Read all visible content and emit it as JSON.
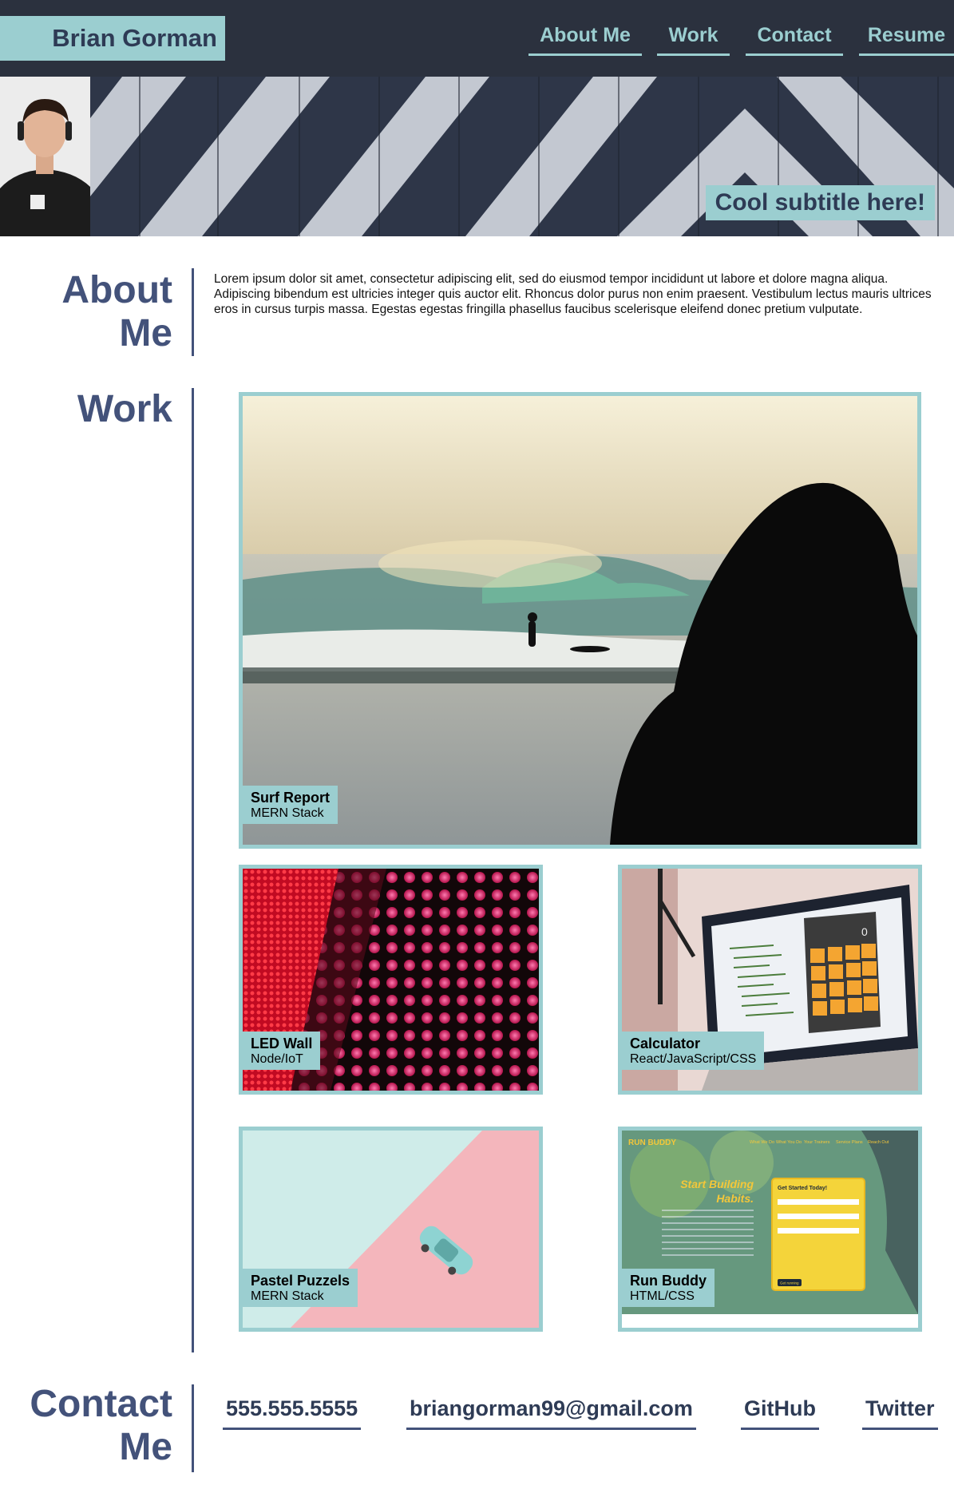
{
  "header": {
    "brand": "Brian Gorman",
    "nav": [
      {
        "label": "About Me"
      },
      {
        "label": "Work"
      },
      {
        "label": "Contact"
      },
      {
        "label": "Resume"
      }
    ]
  },
  "hero": {
    "subtitle": "Cool subtitle here!"
  },
  "about": {
    "title_line1": "About",
    "title_line2": "Me",
    "text": "Lorem ipsum dolor sit amet, consectetur adipiscing elit, sed do eiusmod tempor incididunt ut labore et dolore magna aliqua. Adipiscing bibendum est ultricies integer quis auctor elit. Rhoncus dolor purus non enim praesent. Vestibulum lectus mauris ultrices eros in cursus turpis massa. Egestas egestas fringilla phasellus faucibus scelerisque eleifend donec pretium vulputate."
  },
  "work": {
    "title": "Work",
    "projects": [
      {
        "title": "Surf Report",
        "stack": "MERN Stack"
      },
      {
        "title": "LED Wall",
        "stack": "Node/IoT"
      },
      {
        "title": "Calculator",
        "stack": "React/JavaScript/CSS"
      },
      {
        "title": "Pastel Puzzels",
        "stack": "MERN Stack"
      },
      {
        "title": "Run Buddy",
        "stack": "HTML/CSS"
      }
    ],
    "run_buddy_screenshot": {
      "logo": "RUN BUDDY",
      "nav": [
        "What We Do",
        "What You Do",
        "Your Trainers",
        "Service Plans",
        "Reach Out"
      ],
      "headline_line1": "Start Building",
      "headline_line2": "Habits.",
      "form_title": "Get Started Today!",
      "button": "Get running"
    },
    "calculator_display": "0"
  },
  "contact": {
    "title_line1": "Contact",
    "title_line2": "Me",
    "links": [
      {
        "label": "555.555.5555"
      },
      {
        "label": "briangorman99@gmail.com"
      },
      {
        "label": "GitHub"
      },
      {
        "label": "Twitter"
      }
    ]
  },
  "colors": {
    "header_bg": "#2b313e",
    "accent": "#9bced0",
    "heading": "#43527a",
    "brand_text": "#2e3b55"
  }
}
